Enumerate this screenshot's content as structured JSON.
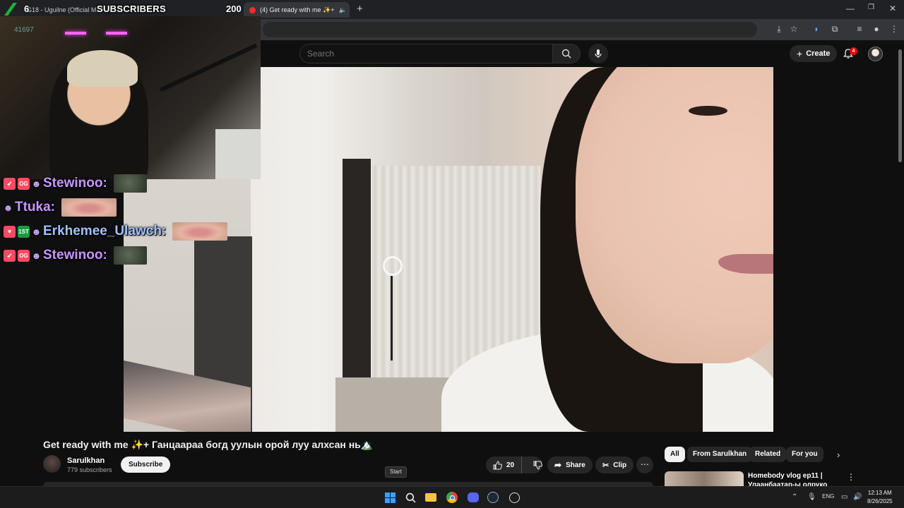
{
  "browser": {
    "tabs": [
      {
        "label": "G18 - Uguilne (Official M...",
        "active": false
      },
      {
        "label": "(4) Get ready with me ✨+",
        "active": true
      }
    ],
    "new_tab": "+",
    "window_controls": [
      "—",
      "❐",
      "✕"
    ]
  },
  "stream_overlay": {
    "sub_goal": {
      "current": "6",
      "label": "SUBSCRIBERS",
      "target": "200"
    },
    "viewer_count": "41697",
    "chat": [
      {
        "badges": [
          "rocket",
          "og",
          "cat"
        ],
        "name": "Stewinoo:",
        "color": "#c996ff",
        "emote": "frog"
      },
      {
        "badges": [
          "cat"
        ],
        "name": "Ttuka:",
        "color": "#c996ff",
        "emote": "lips"
      },
      {
        "badges": [
          "heart",
          "tier",
          "cat"
        ],
        "name": "Erkhemee_Ulawch:",
        "color": "#9fc3ff",
        "emote": "lips"
      },
      {
        "badges": [
          "rocket",
          "og",
          "cat"
        ],
        "name": "Stewinoo:",
        "color": "#c996ff",
        "emote": "frog"
      }
    ],
    "badge_text": {
      "og": "OG",
      "tier": "1ST"
    }
  },
  "youtube": {
    "search": {
      "placeholder": "Search"
    },
    "create_label": "Create",
    "notifications": "4",
    "video": {
      "title": "Get ready with me ✨+ Ганцаараа богд уулын орой луу алхсан нь🏔️",
      "channel": "Sarulkhan",
      "subscribers": "779 subscribers",
      "subscribe_label": "Subscribe",
      "likes": "20",
      "share_label": "Share",
      "clip_label": "Clip"
    },
    "chips": [
      "All",
      "From Sarulkhan",
      "Related",
      "For you"
    ],
    "recommendation": {
      "title": "Homebody vlog ep11 | Улаанбаатар-ы олруко"
    }
  },
  "tooltip": "Start",
  "taskbar": {
    "lang": "ENG",
    "time": "12:13 AM",
    "date": "8/26/2025"
  },
  "colors": {
    "accent_red": "#ff0000",
    "chip_active": "#f1f1f1",
    "windows_blue": "#3aa0ff"
  }
}
